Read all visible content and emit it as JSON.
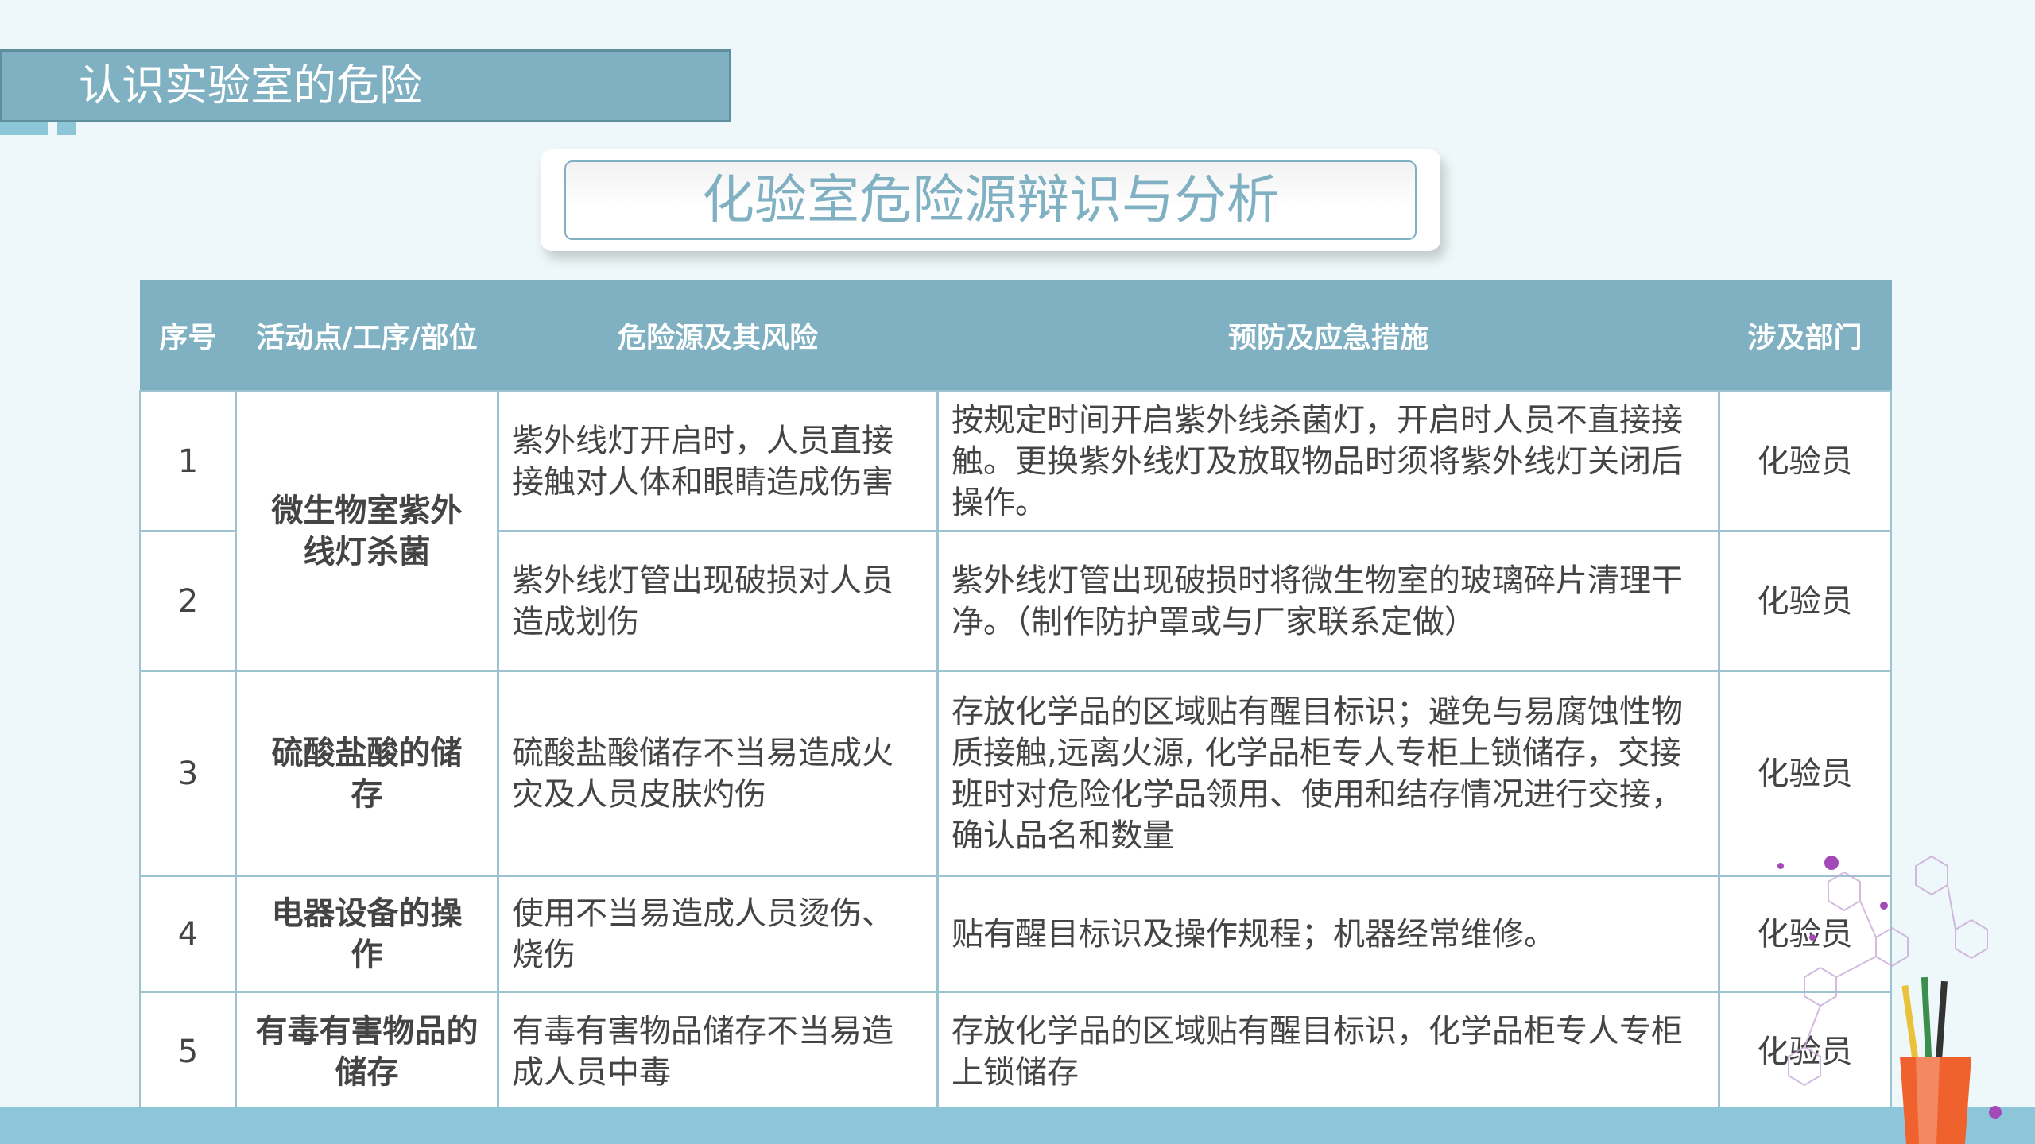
{
  "header": {
    "title": "认识实验室的危险"
  },
  "subtitle": "化验室危险源辩识与分析",
  "table": {
    "columns": [
      "序号",
      "活动点/工序/部位",
      "危险源及其风险",
      "预防及应急措施",
      "涉及部门"
    ],
    "activities": [
      "微生物室紫外线灯杀菌",
      "硫酸盐酸的储存",
      "电器设备的操作",
      "有毒有害物品的储存"
    ],
    "rows": [
      {
        "num": "1",
        "risk": "紫外线灯开启时，人员直接接触对人体和眼睛造成伤害",
        "measure": "按规定时间开启紫外线杀菌灯，开启时人员不直接接触。更换紫外线灯及放取物品时须将紫外线灯关闭后操作。",
        "dept": "化验员"
      },
      {
        "num": "2",
        "risk": "紫外线灯管出现破损对人员造成划伤",
        "measure": "紫外线灯管出现破损时将微生物室的玻璃碎片清理干净。（制作防护罩或与厂家联系定做）",
        "dept": "化验员"
      },
      {
        "num": "3",
        "risk": "硫酸盐酸储存不当易造成火灾及人员皮肤灼伤",
        "measure": "存放化学品的区域贴有醒目标识；避免与易腐蚀性物质接触,远离火源, 化学品柜专人专柜上锁储存，交接班时对危险化学品领用、使用和结存情况进行交接，确认品名和数量",
        "dept": "化验员"
      },
      {
        "num": "4",
        "risk": "使用不当易造成人员烫伤、烧伤",
        "measure": "贴有醒目标识及操作规程；机器经常维修。",
        "dept": "化验员"
      },
      {
        "num": "5",
        "risk": "有毒有害物品储存不当易造成人员中毒",
        "measure": "存放化学品的区域贴有醒目标识，化学品柜专人专柜上锁储存",
        "dept": "化验员"
      }
    ]
  },
  "colors": {
    "accent": "#7fb1c2",
    "activity_text": "#7a1e80",
    "background": "#eef7f9"
  },
  "decoration": {
    "icon": "chemistry-molecules-pencil-cup-icon"
  }
}
